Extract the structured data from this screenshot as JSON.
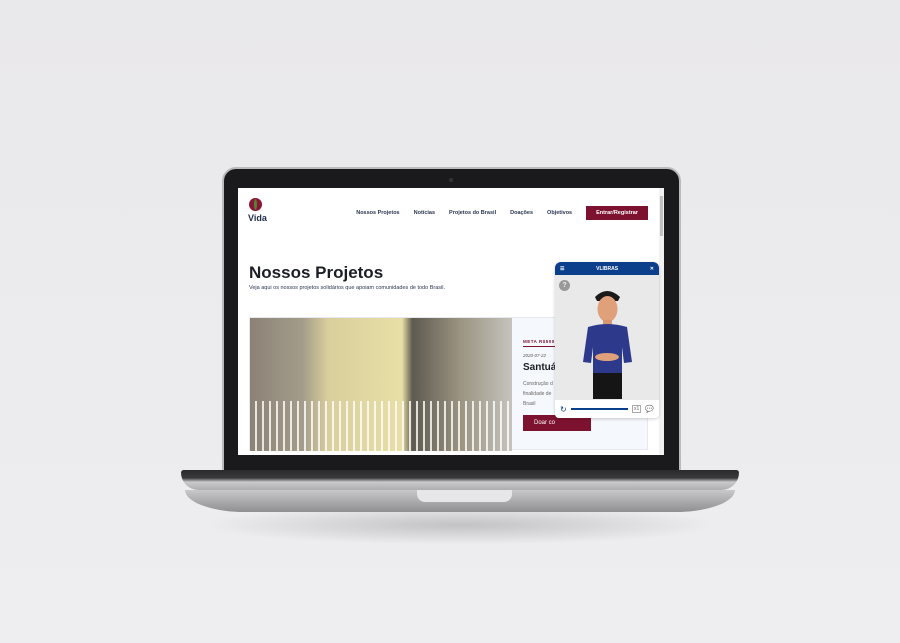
{
  "site": {
    "brand": "Vida",
    "nav": [
      "Nossos Projetos",
      "Notícias",
      "Projetos do Brasil",
      "Doações",
      "Objetivos"
    ],
    "login": "Entrar/Registrar"
  },
  "hero": {
    "title": "Nossos Projetos",
    "subtitle": "Veja aqui os nossos projetos solidários que apoiam comunidades de todo Brasil."
  },
  "project": {
    "meta": "META R$500",
    "date": "2020-07-22",
    "title": "Santuár",
    "description": "Construção d finalidade de Brasil",
    "donate": "Doar co"
  },
  "vlibras": {
    "title": "VLIBRAS",
    "speed": "x1",
    "help": "?"
  },
  "colors": {
    "accent": "#7d1230",
    "vlibras": "#0b3f8c"
  }
}
